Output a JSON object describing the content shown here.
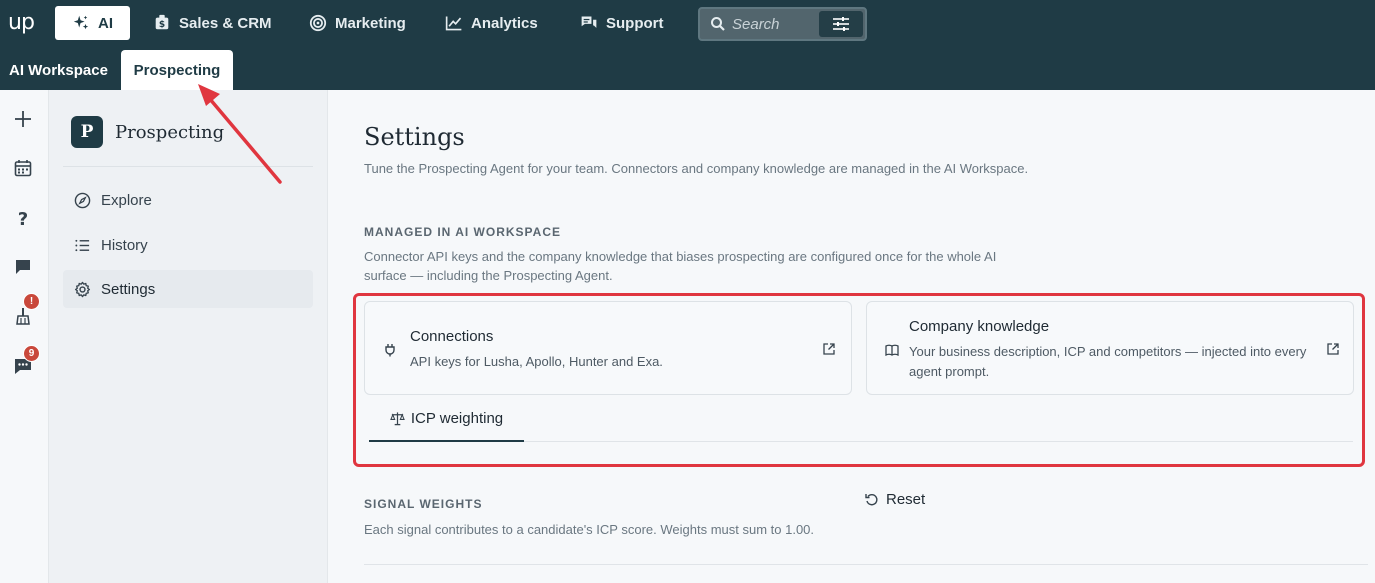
{
  "topbar": {
    "logo": "up",
    "nav": [
      {
        "label": "AI",
        "icon": "sparkles-icon",
        "active": true
      },
      {
        "label": "Sales & CRM",
        "icon": "money-bag-icon",
        "active": false
      },
      {
        "label": "Marketing",
        "icon": "target-icon",
        "active": false
      },
      {
        "label": "Analytics",
        "icon": "chart-line-icon",
        "active": false
      },
      {
        "label": "Support",
        "icon": "chat-bubbles-icon",
        "active": false
      }
    ],
    "search": {
      "placeholder": "Search",
      "filter_icon": "sliders-icon"
    }
  },
  "subnav": [
    {
      "label": "AI Workspace",
      "active": false
    },
    {
      "label": "Prospecting",
      "active": true
    }
  ],
  "rail": {
    "items": [
      {
        "icon": "plus-icon"
      },
      {
        "icon": "calendar-icon"
      },
      {
        "icon": "question-icon"
      },
      {
        "icon": "chat-icon"
      },
      {
        "icon": "broom-icon",
        "badge": "!"
      },
      {
        "icon": "message-dots-icon",
        "badge": "9"
      }
    ]
  },
  "sidebar": {
    "avatar_letter": "P",
    "title": "Prospecting",
    "items": [
      {
        "label": "Explore",
        "icon": "compass-icon",
        "active": false
      },
      {
        "label": "History",
        "icon": "list-icon",
        "active": false
      },
      {
        "label": "Settings",
        "icon": "gear-icon",
        "active": true
      }
    ]
  },
  "main": {
    "title": "Settings",
    "description": "Tune the Prospecting Agent for your team. Connectors and company knowledge are managed in the AI Workspace.",
    "managed": {
      "label": "MANAGED IN AI WORKSPACE",
      "text_line1": "Connector API keys and the company knowledge that biases prospecting are configured once for the whole AI",
      "text_line2": "surface — including the Prospecting Agent."
    },
    "cards": [
      {
        "title": "Connections",
        "description": "API keys for Lusha, Apollo, Hunter and Exa.",
        "icon": "plug-icon"
      },
      {
        "title": "Company knowledge",
        "description": "Your business description, ICP and competitors — injected into every agent prompt.",
        "icon": "book-icon"
      }
    ],
    "tabs": [
      {
        "label": "ICP weighting",
        "icon": "scale-icon",
        "active": true
      }
    ],
    "signals": {
      "label": "SIGNAL WEIGHTS",
      "text": "Each signal contributes to a candidate's ICP score. Weights must sum to 1.00.",
      "reset_label": "Reset"
    }
  },
  "colors": {
    "topbar": "#1f3b45",
    "highlight": "#e0363f",
    "badge": "#c9483b"
  }
}
